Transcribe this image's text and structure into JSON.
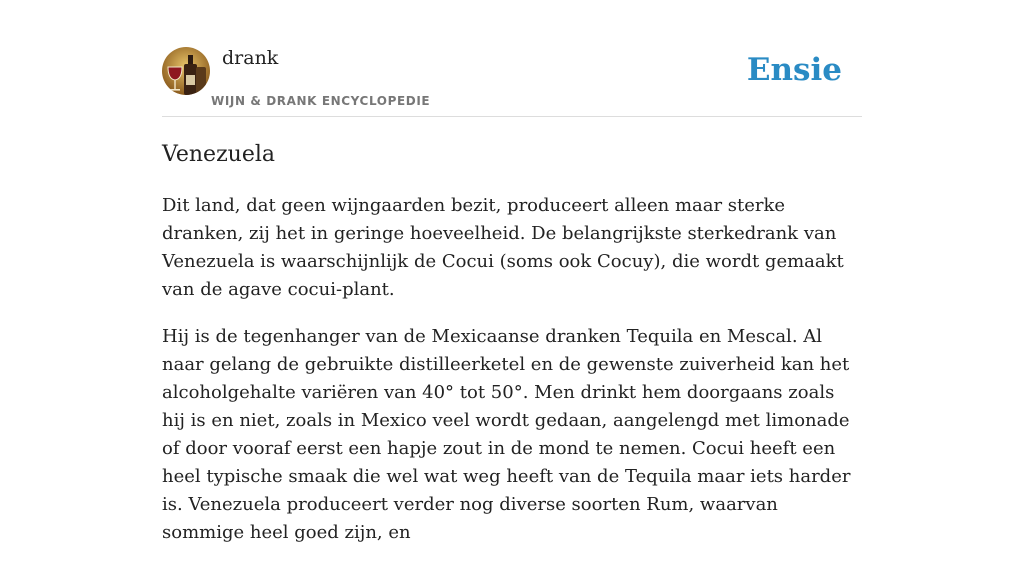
{
  "header": {
    "category_name": "drank",
    "category_subtitle": "WIJN & DRANK ENCYCLOPEDIE",
    "brand": "Ensie",
    "avatar_icon": "wine-bottle-glass-icon"
  },
  "article": {
    "title": "Venezuela",
    "paragraphs": [
      "Dit land, dat geen wijngaarden bezit, produceert alleen maar sterke dranken, zij het in geringe hoeveelheid. De belangrijkste sterkedrank van Venezuela is waarschijnlijk de Cocui (soms ook Cocuy), die wordt gemaakt van de agave cocui-plant.",
      "Hij is de tegenhanger van de Mexicaanse dranken Tequila en Mescal. Al naar gelang de gebruikte distilleerketel en de gewenste zuiverheid kan het alcoholgehalte variëren van 40° tot 50°. Men drinkt hem doorgaans zoals hij is en niet, zoals in Mexico veel wordt gedaan, aangelengd met limonade of door vooraf eerst een hapje zout in de mond te nemen. Cocui heeft een heel typische smaak die wel wat weg heeft van de Tequila maar iets harder is. Venezuela produceert verder nog diverse soorten Rum, waarvan sommige heel goed zijn, en"
    ]
  },
  "colors": {
    "brand": "#2a8bc4",
    "text": "#222222",
    "subtitle": "#777777",
    "divider": "#dddddd"
  }
}
